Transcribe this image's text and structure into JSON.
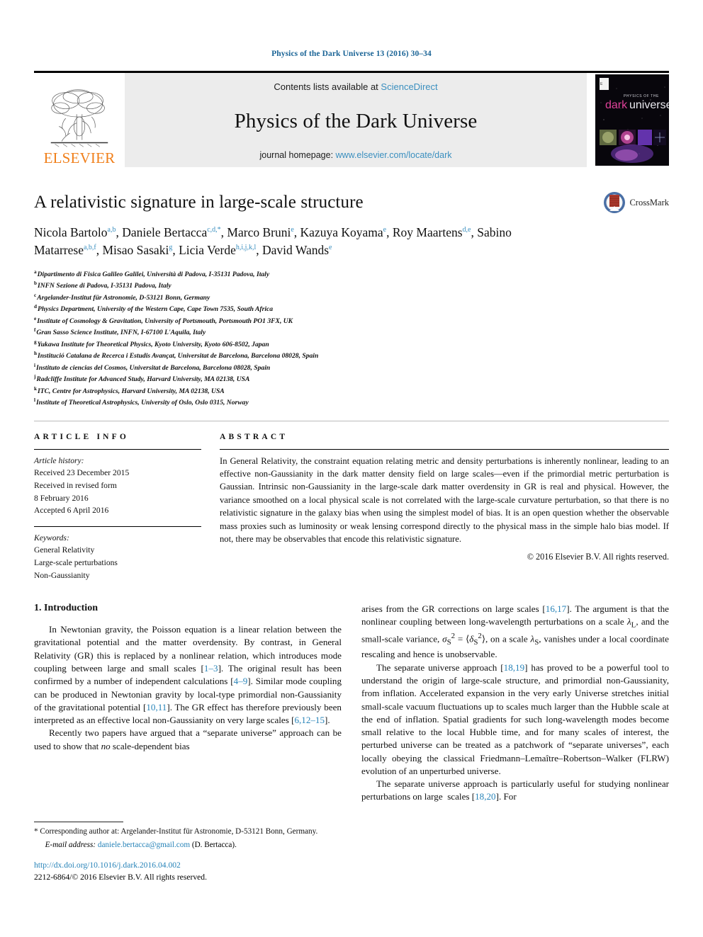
{
  "running_head": "Physics of the Dark Universe 13 (2016) 30–34",
  "header": {
    "contents_prefix": "Contents lists available at",
    "sciencedirect": "ScienceDirect",
    "journal_title": "Physics of the Dark Universe",
    "homepage_prefix": "journal homepage:",
    "homepage_url": "www.elsevier.com/locate/dark",
    "publisher_name": "ELSEVIER",
    "cover_title_small": "PHYSICS OF THE",
    "cover_title_dark": "dark",
    "cover_title_universe": "universe",
    "colors": {
      "link": "#3a8fbf",
      "running_head": "#1a6496",
      "elsevier_orange": "#f07f1a",
      "band_gray": "#ececec"
    }
  },
  "article": {
    "title": "A relativistic signature in large-scale structure",
    "crossmark_label": "CrossMark",
    "authors": [
      {
        "name": "Nicola Bartolo",
        "sup": "a,b",
        "sep": ", "
      },
      {
        "name": "Daniele Bertacca",
        "sup": "c,d,*",
        "sep": ", "
      },
      {
        "name": "Marco Bruni",
        "sup": "e",
        "sep": ", "
      },
      {
        "name": "Kazuya Koyama",
        "sup": "e",
        "sep": ", "
      },
      {
        "name": "Roy Maartens",
        "sup": "d,e",
        "sep": ", "
      },
      {
        "name": "Sabino Matarrese",
        "sup": "a,b,f",
        "sep": ", "
      },
      {
        "name": "Misao Sasaki",
        "sup": "g",
        "sep": ", "
      },
      {
        "name": "Licia Verde",
        "sup": "h,i,j,k,l",
        "sep": ", "
      },
      {
        "name": "David Wands",
        "sup": "e",
        "sep": ""
      }
    ],
    "affiliations": [
      {
        "key": "a",
        "text": "Dipartimento di Fisica Galileo Galilei, Università di Padova, I-35131 Padova, Italy"
      },
      {
        "key": "b",
        "text": "INFN Sezione di Padova, I-35131 Padova, Italy"
      },
      {
        "key": "c",
        "text": "Argelander-Institut für Astronomie, D-53121 Bonn, Germany"
      },
      {
        "key": "d",
        "text": "Physics Department, University of the Western Cape, Cape Town 7535, South Africa"
      },
      {
        "key": "e",
        "text": "Institute of Cosmology & Gravitation, University of Portsmouth, Portsmouth PO1 3FX, UK"
      },
      {
        "key": "f",
        "text": "Gran Sasso Science Institute, INFN, I-67100 L'Aquila, Italy"
      },
      {
        "key": "g",
        "text": "Yukawa Institute for Theoretical Physics, Kyoto University, Kyoto 606-8502, Japan"
      },
      {
        "key": "h",
        "text": "Institució Catalana de Recerca i Estudis Avançat, Universitat de Barcelona, Barcelona 08028, Spain"
      },
      {
        "key": "i",
        "text": "Instituto de ciencias del Cosmos, Universitat de Barcelona, Barcelona 08028, Spain"
      },
      {
        "key": "j",
        "text": "Radcliffe Institute for Advanced Study, Harvard University, MA 02138, USA"
      },
      {
        "key": "k",
        "text": "ITC, Centre for Astrophysics, Harvard University, MA 02138, USA"
      },
      {
        "key": "l",
        "text": "Institute of Theoretical Astrophysics, University of Oslo, Oslo 0315, Norway"
      }
    ]
  },
  "article_info": {
    "heading": "ARTICLE INFO",
    "history_label": "Article history:",
    "history_lines": [
      "Received 23 December 2015",
      "Received in revised form",
      "8 February 2016",
      "Accepted 6 April 2016"
    ],
    "keywords_label": "Keywords:",
    "keywords": [
      "General Relativity",
      "Large-scale perturbations",
      "Non-Gaussianity"
    ]
  },
  "abstract": {
    "heading": "ABSTRACT",
    "text": "In General Relativity, the constraint equation relating metric and density perturbations is inherently nonlinear, leading to an effective non-Gaussianity in the dark matter density field on large scales—even if the primordial metric perturbation is Gaussian. Intrinsic non-Gaussianity in the large-scale dark matter overdensity in GR is real and physical. However, the variance smoothed on a local physical scale is not correlated with the large-scale curvature perturbation, so that there is no relativistic signature in the galaxy bias when using the simplest model of bias. It is an open question whether the observable mass proxies such as luminosity or weak lensing correspond directly to the physical mass in the simple halo bias model. If not, there may be observables that encode this relativistic signature.",
    "copyright": "© 2016 Elsevier B.V. All rights reserved."
  },
  "body": {
    "section_number_title": "1. Introduction",
    "left_paragraphs": [
      "In Newtonian gravity, the Poisson equation is a linear relation between the gravitational potential and the matter overdensity. By contrast, in General Relativity (GR) this is replaced by a nonlinear relation, which introduces mode coupling between large and small scales [1–3]. The original result has been confirmed by a number of independent calculations [4–9]. Similar mode coupling can be produced in Newtonian gravity by local-type primordial non-Gaussianity of the gravitational potential [10,11]. The GR effect has therefore previously been interpreted as an effective local non-Gaussianity on very large scales [6,12–15].",
      "Recently two papers have argued that a “separate universe” approach can be used to show that no scale-dependent bias"
    ],
    "right_paragraphs": [
      "arises from the GR corrections on large scales [16,17]. The argument is that the nonlinear coupling between long-wavelength perturbations on a scale λL, and the small-scale variance, σS2 = ⟨δS2⟩, on a scale λS, vanishes under a local coordinate rescaling and hence is unobservable.",
      "The separate universe approach [18,19] has proved to be a powerful tool to understand the origin of large-scale structure, and primordial non-Gaussianity, from inflation. Accelerated expansion in the very early Universe stretches initial small-scale vacuum fluctuations up to scales much larger than the Hubble scale at the end of inflation. Spatial gradients for such long-wavelength modes become small relative to the local Hubble time, and for many scales of interest, the perturbed universe can be treated as a patchwork of “separate universes”, each locally obeying the classical Friedmann–Lemaître–Robertson–Walker (FLRW) evolution of an unperturbed universe.",
      "The separate universe approach is particularly useful for studying nonlinear perturbations on large  scales [18,20]. For"
    ]
  },
  "footnote": {
    "star": "*",
    "corresponding": "Corresponding author at: Argelander-Institut für Astronomie, D-53121 Bonn, Germany.",
    "email_label": "E-mail address:",
    "email": "daniele.bertacca@gmail.com",
    "email_suffix": "(D. Bertacca).",
    "doi": "http://dx.doi.org/10.1016/j.dark.2016.04.002",
    "issn_line": "2212-6864/© 2016 Elsevier B.V. All rights reserved."
  }
}
